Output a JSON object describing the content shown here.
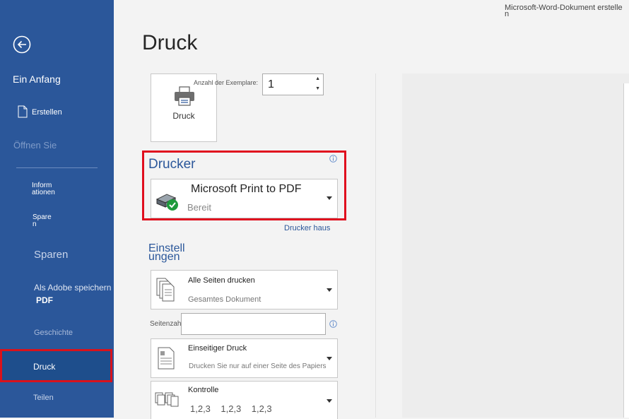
{
  "window": {
    "document_title": "Microsoft-Word-Dokument erstelle n"
  },
  "sidebar": {
    "home": "Ein Anfang",
    "new": "Erstellen",
    "open": "Öffnen Sie",
    "info": "Inform ationen",
    "save": "Spare n",
    "save_as": "Sparen",
    "adobe_line1": "Als Adobe speichern",
    "adobe_line2": "PDF",
    "history": "Geschichte",
    "print": "Druck",
    "share": "Teilen"
  },
  "main": {
    "title": "Druck",
    "print_button_label": "Druck",
    "copies_label": "Anzahl der Exemplare:",
    "copies_value": "1",
    "printer": {
      "heading": "Drucker",
      "name": "Microsoft Print to PDF",
      "status": "Bereit",
      "properties_link": "Drucker haus"
    },
    "settings": {
      "heading": "Einstell ungen",
      "range_title": "Alle Seiten drucken",
      "range_sub": "Gesamtes Dokument",
      "pages_label": "Seitenzahl:",
      "pages_value": "",
      "sides_title": "Einseitiger Druck",
      "sides_sub": "Drucken Sie nur auf einer Seite des Papiers",
      "collate_title": "Kontrolle",
      "collate_sub": "1,2,3    1,2,3    1,2,3"
    }
  },
  "colors": {
    "sidebar_bg": "#2b579a",
    "sidebar_active": "#1e4e8c",
    "highlight_red": "#e00e1e",
    "accent_blue": "#2b579a"
  }
}
